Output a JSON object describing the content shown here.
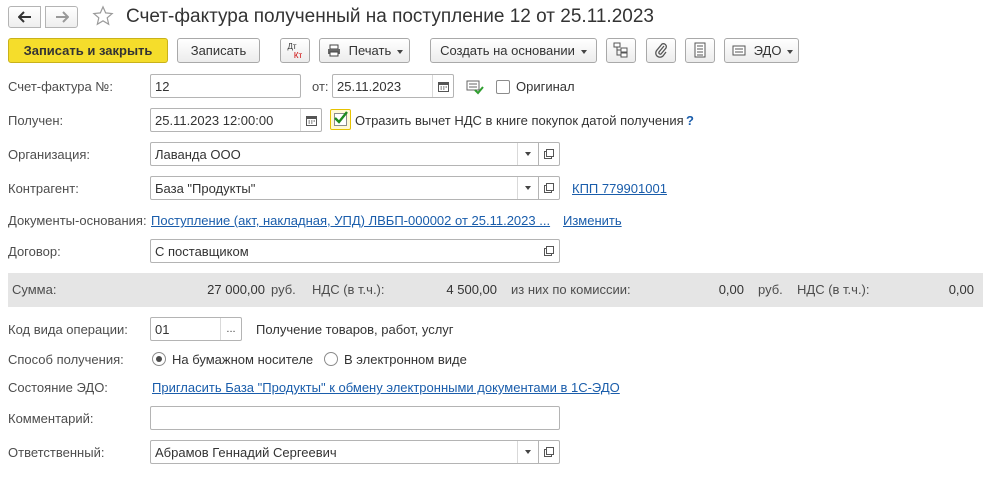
{
  "window": {
    "title": "Счет-фактура полученный на поступление 12 от 25.11.2023"
  },
  "toolbar": {
    "save_close": "Записать и закрыть",
    "save": "Записать",
    "dt_kt_top": "Дт",
    "dt_kt_bottom": "Кт",
    "print": "Печать",
    "create_based": "Создать на основании",
    "edo": "ЭДО"
  },
  "form": {
    "invoice_label": "Счет-фактура №:",
    "invoice_no": "12",
    "from_label": "от:",
    "invoice_date": "25.11.2023",
    "original_label": "Оригинал",
    "received_label": "Получен:",
    "received_datetime": "25.11.2023 12:00:00",
    "vat_deduction_label": "Отразить вычет НДС в книге покупок датой получения",
    "help_mark": "?",
    "org_label": "Организация:",
    "org_value": "Лаванда ООО",
    "counterparty_label": "Контрагент:",
    "counterparty_value": "База \"Продукты\"",
    "kpp_link": "КПП 779901001",
    "base_docs_label": "Документы-основания:",
    "base_docs_link": "Поступление (акт, накладная, УПД) ЛВБП-000002 от 25.11.2023 ...",
    "change_link": "Изменить",
    "contract_label": "Договор:",
    "contract_value": "С поставщиком",
    "op_code_label": "Код вида операции:",
    "op_code_value": "01",
    "op_code_desc": "Получение товаров, работ, услуг",
    "receive_method_label": "Способ получения:",
    "radio_paper": "На бумажном носителе",
    "radio_electronic": "В электронном виде",
    "edo_state_label": "Состояние ЭДО:",
    "edo_invite_link": "Пригласить База \"Продукты\"  к обмену электронными документами в 1С-ЭДО",
    "comment_label": "Комментарий:",
    "comment_value": "",
    "responsible_label": "Ответственный:",
    "responsible_value": "Абрамов Геннадий Сергеевич",
    "ellipsis": "..."
  },
  "summary": {
    "sum_label": "Сумма:",
    "sum_value": "27 000,00",
    "currency": "руб.",
    "vat_incl_label": "НДС (в т.ч.):",
    "vat_value": "4 500,00",
    "commission_label": "из них по комиссии:",
    "commission_value": "0,00",
    "currency2": "руб.",
    "vat_incl_label2": "НДС (в т.ч.):",
    "commission_vat_value": "0,00"
  }
}
